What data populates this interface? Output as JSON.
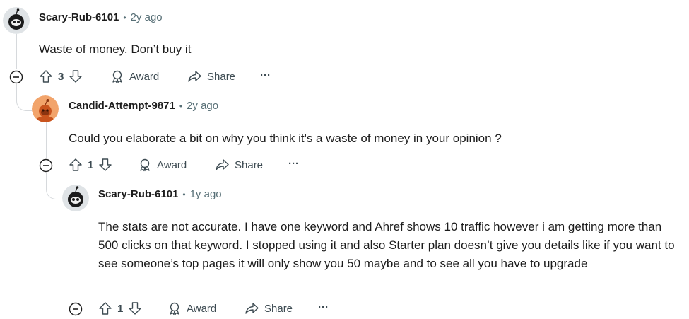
{
  "comments": [
    {
      "author": "Scary-Rub-6101",
      "separator": "•",
      "age": "2y ago",
      "body": "Waste of money. Don’t buy it",
      "score": "3",
      "award_label": "Award",
      "share_label": "Share",
      "more_label": "···"
    },
    {
      "author": "Candid-Attempt-9871",
      "separator": "•",
      "age": "2y ago",
      "body": "Could you elaborate a bit on why you think it's a waste of money in your opinion ?",
      "score": "1",
      "award_label": "Award",
      "share_label": "Share",
      "more_label": "···"
    },
    {
      "author": "Scary-Rub-6101",
      "separator": "•",
      "age": "1y ago",
      "body": "The stats are not accurate. I have one keyword and Ahref shows 10 traffic however i am getting more than 500 clicks on that keyword. I stopped using it and also Starter plan doesn’t give you details like if you want to see someone’s top pages it will only show you 50 maybe and to see all you have to upgrade",
      "score": "1",
      "award_label": "Award",
      "share_label": "Share",
      "more_label": "···"
    }
  ],
  "icons": {
    "avatar_1": "snoo-dark-avatar-icon",
    "avatar_2": "snoo-orange-avatar-icon",
    "upvote": "arrow-up-icon",
    "downvote": "arrow-down-icon",
    "award": "award-icon",
    "share": "share-arrow-icon",
    "collapse": "collapse-minus-icon"
  },
  "colors": {
    "text": "#1c1c1c",
    "meta": "#576f76",
    "action": "#3d4b52",
    "thread_line": "#d6d9dc",
    "avatar_orange": "#f2a46b"
  }
}
